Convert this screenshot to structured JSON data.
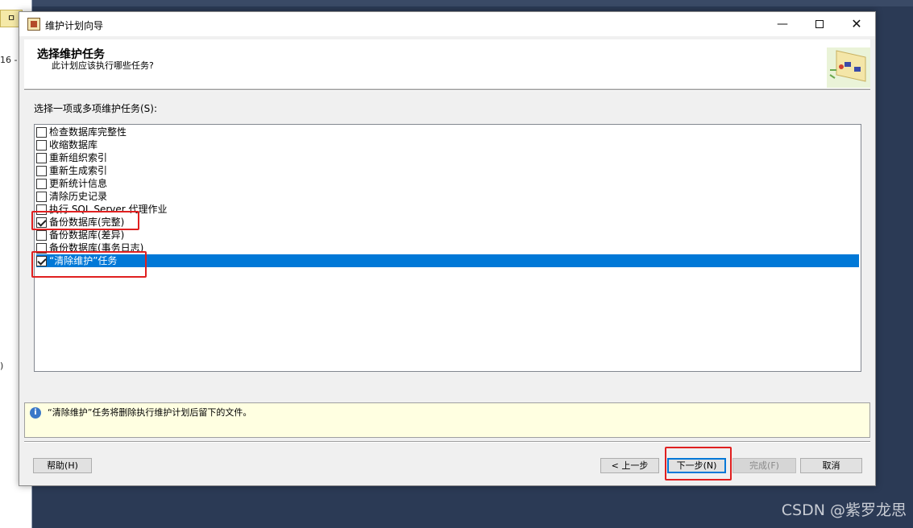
{
  "background": {
    "left_tab_label": "ㅁ",
    "left_text_1": "16 -",
    "left_text_2": ")",
    "watermark": "CSDN @紫罗龙思"
  },
  "window": {
    "title": "维护计划向导",
    "minimize_glyph": "—",
    "close_glyph": "✕"
  },
  "header": {
    "title": "选择维护任务",
    "subtitle": "此计划应该执行哪些任务?"
  },
  "list": {
    "label": "选择一项或多项维护任务(S):",
    "items": [
      {
        "label": "检查数据库完整性",
        "checked": false,
        "selected": false
      },
      {
        "label": "收缩数据库",
        "checked": false,
        "selected": false
      },
      {
        "label": "重新组织索引",
        "checked": false,
        "selected": false
      },
      {
        "label": "重新生成索引",
        "checked": false,
        "selected": false
      },
      {
        "label": "更新统计信息",
        "checked": false,
        "selected": false
      },
      {
        "label": "清除历史记录",
        "checked": false,
        "selected": false
      },
      {
        "label": "执行 SQL Server 代理作业",
        "checked": false,
        "selected": false
      },
      {
        "label": "备份数据库(完整)",
        "checked": true,
        "selected": false
      },
      {
        "label": "备份数据库(差异)",
        "checked": false,
        "selected": false
      },
      {
        "label": "备份数据库(事务日志)",
        "checked": false,
        "selected": false
      },
      {
        "label": "“清除维护”任务",
        "checked": true,
        "selected": true
      }
    ]
  },
  "info": {
    "icon": "info-icon",
    "text": "“清除维护”任务将删除执行维护计划后留下的文件。"
  },
  "buttons": {
    "help": "帮助(H)",
    "back": "< 上一步",
    "next": "下一步(N)",
    "finish": "完成(F)",
    "cancel": "取消"
  },
  "colors": {
    "selection": "#0078d7",
    "highlight_box": "#e02020",
    "info_background": "#ffffe1"
  }
}
